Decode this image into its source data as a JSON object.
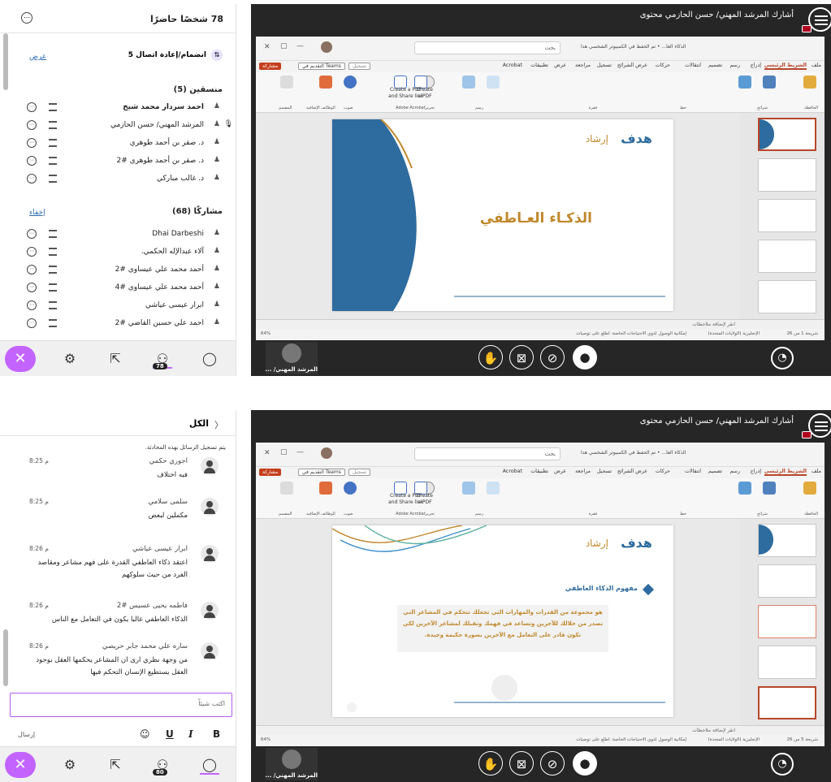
{
  "shared": {
    "meeting_title": "أشارك المرشد المهني/ حسن الحازمي محتوى",
    "ppt_search_placeholder": "بحث",
    "ppt_file_title": "الذكاء العا... • تم الحفظ في الكمبيوتر الشخصي هذا",
    "tabs": [
      "ملف",
      "الشريط الرئيسي",
      "إدراج",
      "رسم",
      "تصميم",
      "انتقالات",
      "حركات",
      "عرض الشرائح",
      "تسجيل",
      "مراجعة",
      "عرض",
      "تطبيقات",
      "Acrobat"
    ],
    "share_label": "مشاركة",
    "teams_label": "التقديم في Teams",
    "record_label": "تسجيل",
    "acrobat_create_pdf": "Create a PDF",
    "acrobat_share_link": "and Share link",
    "acrobat_create": "Create",
    "acrobat_a_pdf": "a PDF",
    "acrobat_group": "Adobe Acrobat",
    "ribbon_groups": [
      "الحافظة",
      "شرائح",
      "خط",
      "فقرة",
      "رسم",
      "تحرير",
      "صوت",
      "الوظائف الإضافية",
      "المصمم"
    ],
    "notes_placeholder": "انقر لإضافة ملاحظات",
    "status_accessibility": "إمكانية الوصول لذوي الاحتياجات الخاصة: اطلع على توصيات",
    "status_lang": "الإنجليزية (الولايات المتحدة)",
    "status_zoom": "64%",
    "presenter_name": "المرشد المهني/ ...",
    "brand_text": "هدف",
    "brand_sub": "إرشاد",
    "badge_ring": "⊘"
  },
  "frame1": {
    "status_slide": "شريحة 1 من 26",
    "participants_count_title": "78 شخصًا حاضرًا",
    "join_label": "انضمام/إعادة اتصال 5",
    "show_link": "عرض",
    "coordinators_title": "منسقين (5)",
    "coordinators": [
      "احمد سردار محمد شيخ",
      "المرشد المهني/ حسن الحازمي",
      "د. صقر بن أحمد طوهري",
      "د. صقر بن أحمد طوهري #2",
      "د. غالب مباركي"
    ],
    "participants_title": "مشاركًا (68)",
    "hide_link": "إخفاء",
    "participants": [
      "Dhai Darbeshi",
      "آلاء عبدالإله الحكمي.",
      "أحمد محمد علي عيساوي #2",
      "أحمد محمد علي عيساوي #4",
      "ابرار عيسى عياشي",
      "احمد علي حسين القاضي #2"
    ],
    "slide_title": "الذكـاء العـاطفي",
    "badge_count": "78"
  },
  "frame2": {
    "status_slide": "شريحة 5 من 26",
    "chat_back": "الكل",
    "chat_notice": "يتم تسجيل الرسائل بهذه المحادثة.",
    "messages": [
      {
        "author": "اجوري حكمي",
        "time": "8:25 م",
        "body": "فيه اختلاف"
      },
      {
        "author": "سلمى سلامي",
        "time": "8:25 م",
        "body": "مكملين لبعض"
      },
      {
        "author": "ابرار عيسى عياشي",
        "time": "8:26 م",
        "body": "اعتقد ذكاء العاطفي القدرة على فهم مشاعر ومقاصد الفرد من حيث سلوكهم"
      },
      {
        "author": "فاطمه يحيى عسيس #2",
        "time": "8:26 م",
        "body": "الذكاء العاطفي غالبا يكون في التعامل مع الناس"
      },
      {
        "author": "ساره علي محمد جابر حريصي",
        "time": "8:26 م",
        "body": "من وجهة نظري ارى ان المشاعر يحكمها العقل بوجود العقل يستطيع الإنسان التحكم فيها"
      }
    ],
    "input_placeholder": "اكتب شيئاً",
    "send_label": "إرسال",
    "slide_heading": "مفهوم الذكاء العاطفي",
    "slide_body": "هو مجموعة من القدرات والمهارات التي تجعلك تتحكم في المشاعر التي تصدر من خلالك للآخرين وتساعد في فهمك وتقبلك لمشاعر الآخرين لكي تكون قادر على التعامل مع الآخرين بصورة حكيمة وجيدة.",
    "badge_count": "80"
  },
  "colors": {
    "accent": "#c364ff",
    "ppt": "#b7472a",
    "slide_blue": "#2e6b9e",
    "slide_gold": "#c0882c"
  }
}
